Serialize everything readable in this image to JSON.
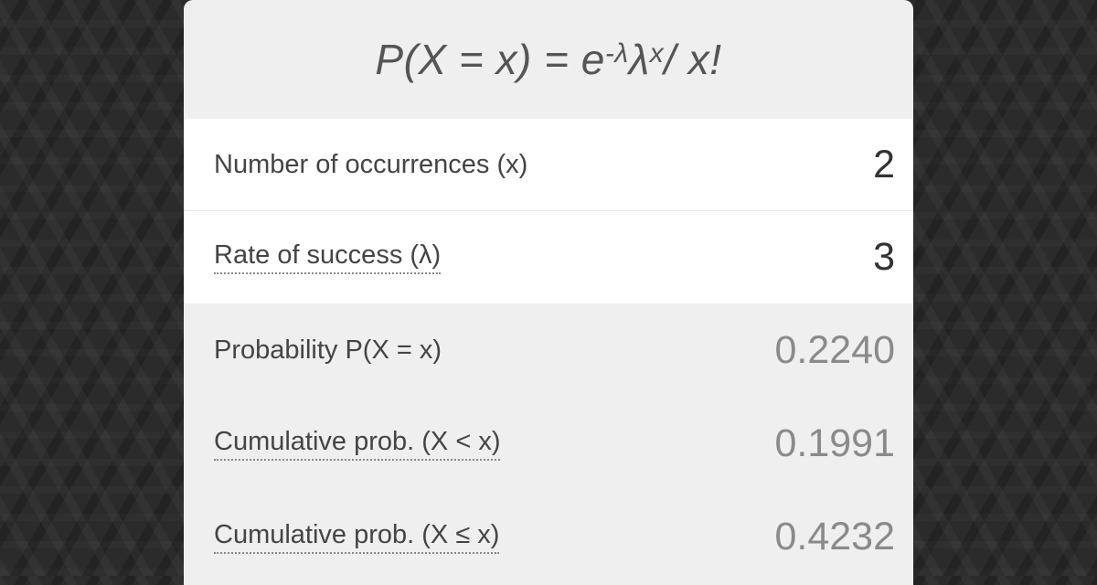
{
  "formula": {
    "lhs": "P(X = x) = e",
    "exp1": "-λ",
    "mid": "λ",
    "exp2": "x",
    "rhs": " / x!"
  },
  "inputs": [
    {
      "label": "Number of occurrences (x)",
      "value": "2"
    },
    {
      "label": "Rate of success (λ)",
      "value": "3"
    }
  ],
  "results": [
    {
      "label": "Probability P(X = x)",
      "value": "0.2240"
    },
    {
      "label": "Cumulative prob. (X < x)",
      "value": "0.1991"
    },
    {
      "label": "Cumulative prob. (X ≤ x)",
      "value": "0.4232"
    }
  ],
  "colors": {
    "background": "#2b2b2b",
    "card": "#efefef",
    "input_row": "#ffffff",
    "result_value": "#8a8a8a"
  }
}
